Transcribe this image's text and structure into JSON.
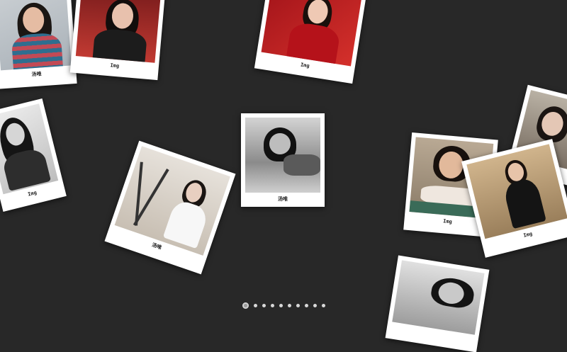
{
  "photos": [
    {
      "id": "p1",
      "caption": "汤唯"
    },
    {
      "id": "p2",
      "caption": "Img"
    },
    {
      "id": "p3",
      "caption": "Img"
    },
    {
      "id": "p4",
      "caption": "Img"
    },
    {
      "id": "p5",
      "caption": "汤唯"
    },
    {
      "id": "p6",
      "caption": "汤唯"
    },
    {
      "id": "p7",
      "caption": "Img"
    },
    {
      "id": "p8",
      "caption": "Img"
    },
    {
      "id": "p9",
      "caption": ""
    },
    {
      "id": "p10",
      "caption": ""
    }
  ],
  "pager": {
    "count": 10,
    "active_index": 0
  },
  "colors": {
    "background": "#282828",
    "card": "#ffffff",
    "dot": "#d8d8d8",
    "dot_active": "#9a9a9a"
  }
}
